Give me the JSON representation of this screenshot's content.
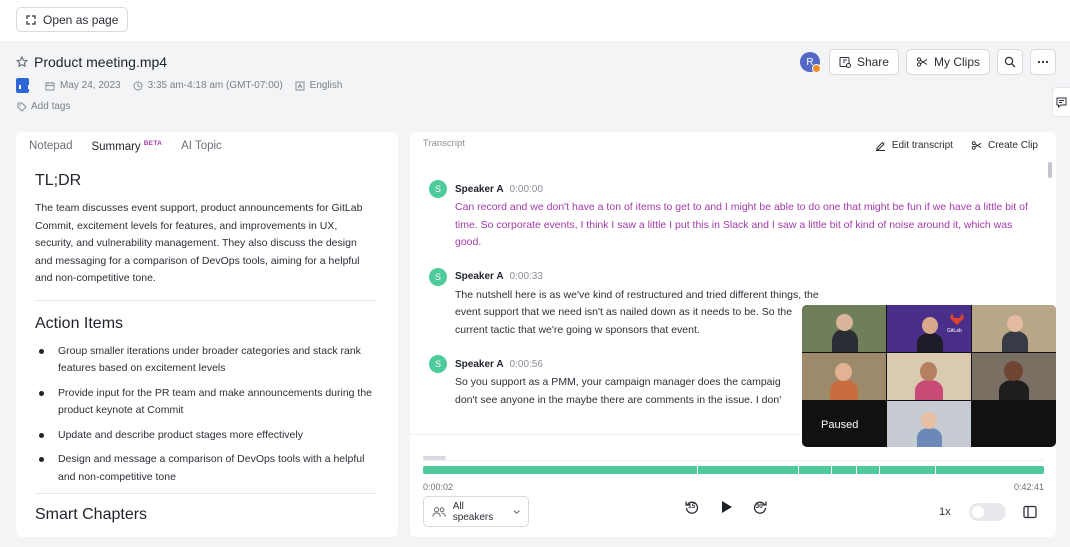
{
  "topbar": {
    "open_page_label": "Open as page"
  },
  "header": {
    "title": "Product meeting.mp4",
    "date": "May 24, 2023",
    "time_range": "3:35 am-4:18 am (GMT-07:00)",
    "language": "English",
    "add_tags_label": "Add tags",
    "avatar_initial": "R",
    "share_label": "Share",
    "clips_label": "My Clips"
  },
  "left_panel": {
    "tabs": [
      {
        "label": "Notepad",
        "badge": ""
      },
      {
        "label": "Summary",
        "badge": "BETA"
      },
      {
        "label": "AI Topic",
        "badge": ""
      }
    ],
    "tldr_heading": "TL;DR",
    "tldr_text": "The team discusses event support, product announcements for GitLab Commit, excitement levels for features, and improvements in UX, security, and vulnerability management. They also discuss the design and messaging for a comparison of DevOps tools, aiming for a helpful and non-competitive tone.",
    "action_items_heading": "Action Items",
    "action_items": [
      "Group smaller iterations under broader categories and stack rank features based on excitement levels",
      "Provide input for the PR team and make announcements during the product keynote at Commit",
      "Update and describe product stages more effectively",
      "Design and message a comparison of DevOps tools with a helpful and non-competitive tone"
    ],
    "next_heading": "Smart Chapters"
  },
  "transcript": {
    "label": "Transcript",
    "edit_label": "Edit transcript",
    "clip_label": "Create Clip",
    "entries": [
      {
        "initial": "S",
        "speaker": "Speaker A",
        "time": "0:00:00",
        "text": "Can record and we don't have a ton of items to get to and I might be able to do one that might be fun if we have a little bit of time. So corporate events, I think I saw a little I put this in Slack and I saw a little bit of kind of noise around it, which was good."
      },
      {
        "initial": "S",
        "speaker": "Speaker A",
        "time": "0:00:33",
        "text": "The nutshell here is as we've kind of restructured and tried different things, the event support that we need isn't as nailed down as it needs to be. So the current tactic that we're going w sponsors that event."
      },
      {
        "initial": "S",
        "speaker": "Speaker A",
        "time": "0:00:56",
        "text": "So you support as a PMM, your campaign manager does the campaig don't see anyone in the maybe there are comments in the issue. I don'"
      }
    ]
  },
  "player": {
    "current_time": "0:00:02",
    "total_time": "0:42:41",
    "speakers_label": "All speakers",
    "rewind_label": "15",
    "forward_label": "30",
    "speed_label": "1x",
    "progress_fraction": 1.0,
    "segment_ticks": [
      0.442,
      0.604,
      0.657,
      0.698,
      0.734,
      0.824
    ]
  },
  "video": {
    "status": "Paused",
    "brand_label": "GitLab"
  },
  "colors": {
    "accent_green": "#50c99c",
    "highlight_purple": "#a33ba8",
    "avatar_blue": "#5468c7"
  }
}
